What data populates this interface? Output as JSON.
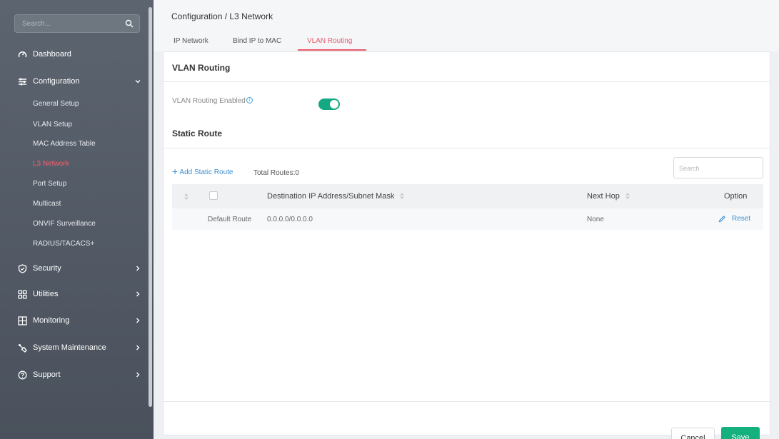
{
  "sidebar": {
    "search_placeholder": "Search...",
    "items": [
      {
        "label": "Dashboard",
        "icon": "dashboard-icon"
      },
      {
        "label": "Configuration",
        "icon": "configuration-icon",
        "expanded": true
      },
      {
        "label": "Security",
        "icon": "shield-icon"
      },
      {
        "label": "Utilities",
        "icon": "utilities-icon"
      },
      {
        "label": "Monitoring",
        "icon": "monitoring-icon"
      },
      {
        "label": "System Maintenance",
        "icon": "wrench-icon"
      },
      {
        "label": "Support",
        "icon": "support-icon"
      }
    ],
    "sub_items": [
      {
        "label": "General Setup"
      },
      {
        "label": "VLAN Setup"
      },
      {
        "label": "MAC Address Table"
      },
      {
        "label": "L3 Network",
        "active": true
      },
      {
        "label": "Port Setup"
      },
      {
        "label": "Multicast"
      },
      {
        "label": "ONVIF Surveillance"
      },
      {
        "label": "RADIUS/TACACS+"
      }
    ]
  },
  "header": {
    "breadcrumb": "Configuration / L3 Network",
    "tabs": [
      {
        "label": "IP Network"
      },
      {
        "label": "Bind IP to MAC"
      },
      {
        "label": "VLAN Routing",
        "active": true
      }
    ]
  },
  "vlan_routing": {
    "title": "VLAN Routing",
    "enabled_label": "VLAN Routing Enabled",
    "enabled": true,
    "info_glyph": "i"
  },
  "static_route": {
    "title": "Static Route",
    "add_label": "Add Static Route",
    "total_label": "Total Routes:0",
    "search_placeholder": "Search",
    "columns": {
      "destination": "Destination IP Address/Subnet Mask",
      "next_hop": "Next Hop",
      "option": "Option"
    },
    "rows": [
      {
        "name": "Default Route",
        "destination": "0.0.0.0/0.0.0.0",
        "next_hop": "None",
        "option": "Reset"
      }
    ]
  },
  "footer": {
    "cancel_label": "Cancel",
    "save_label": "Save"
  },
  "colors": {
    "accent_red": "#e8596b",
    "toggle_green": "#14a982",
    "save_green": "#14b07e",
    "link_blue": "#3b8fd4",
    "sidebar_bg": "#525a65"
  }
}
